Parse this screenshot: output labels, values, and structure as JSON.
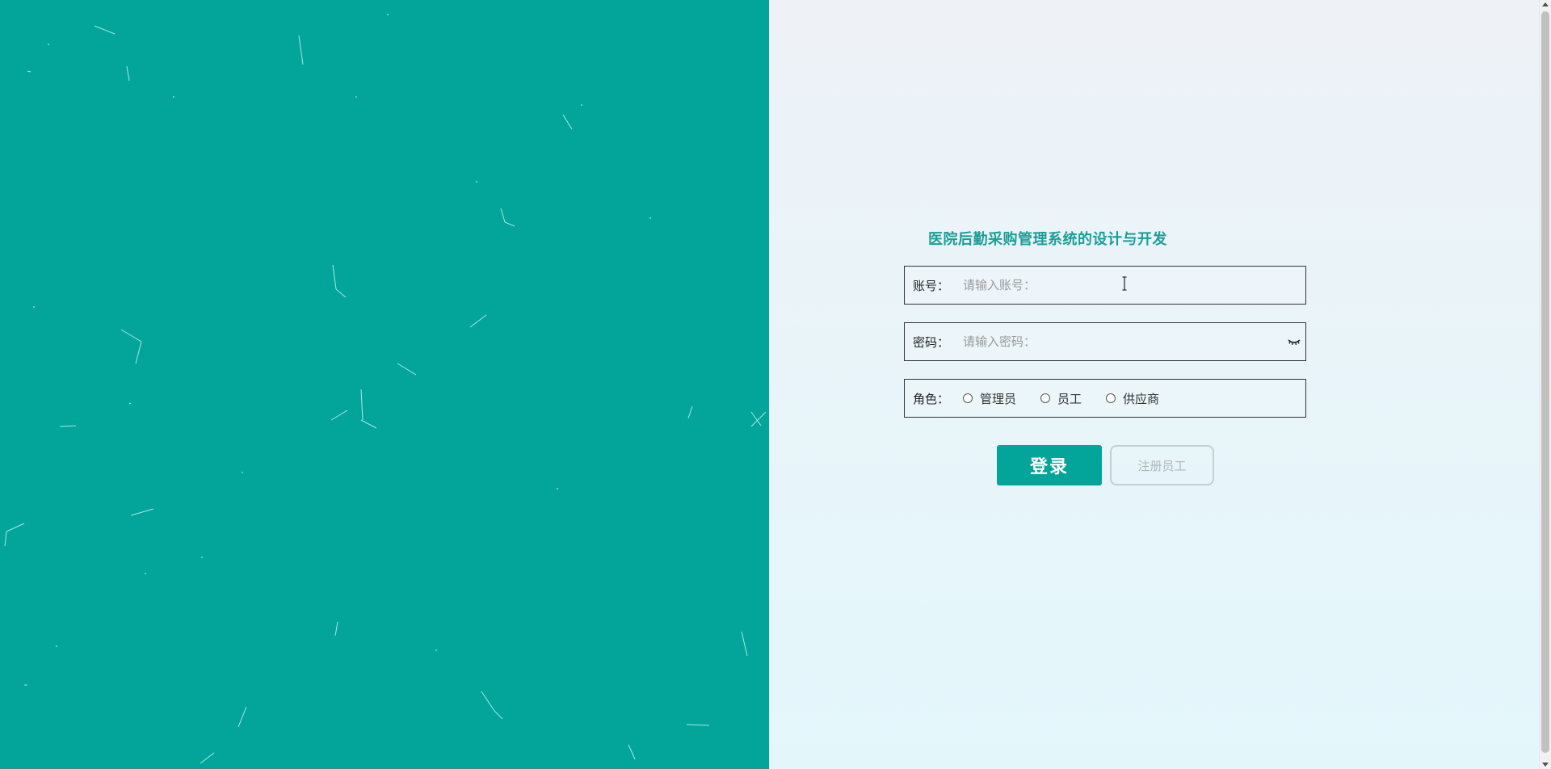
{
  "colors": {
    "brand": "#03a59b",
    "title": "#1b9e96",
    "background_top": "#eef2f7",
    "background_bottom": "#e3f7fb"
  },
  "login": {
    "title": "医院后勤采购管理系统的设计与开发",
    "account": {
      "label": "账号：",
      "placeholder": "请输入账号："
    },
    "password": {
      "label": "密码：",
      "placeholder": "请输入密码：",
      "toggle_icon": "eye-closed-icon"
    },
    "role": {
      "label": "角色：",
      "options": [
        "管理员",
        "员工",
        "供应商"
      ]
    },
    "login_button": "登录",
    "register_button": "注册员工"
  }
}
